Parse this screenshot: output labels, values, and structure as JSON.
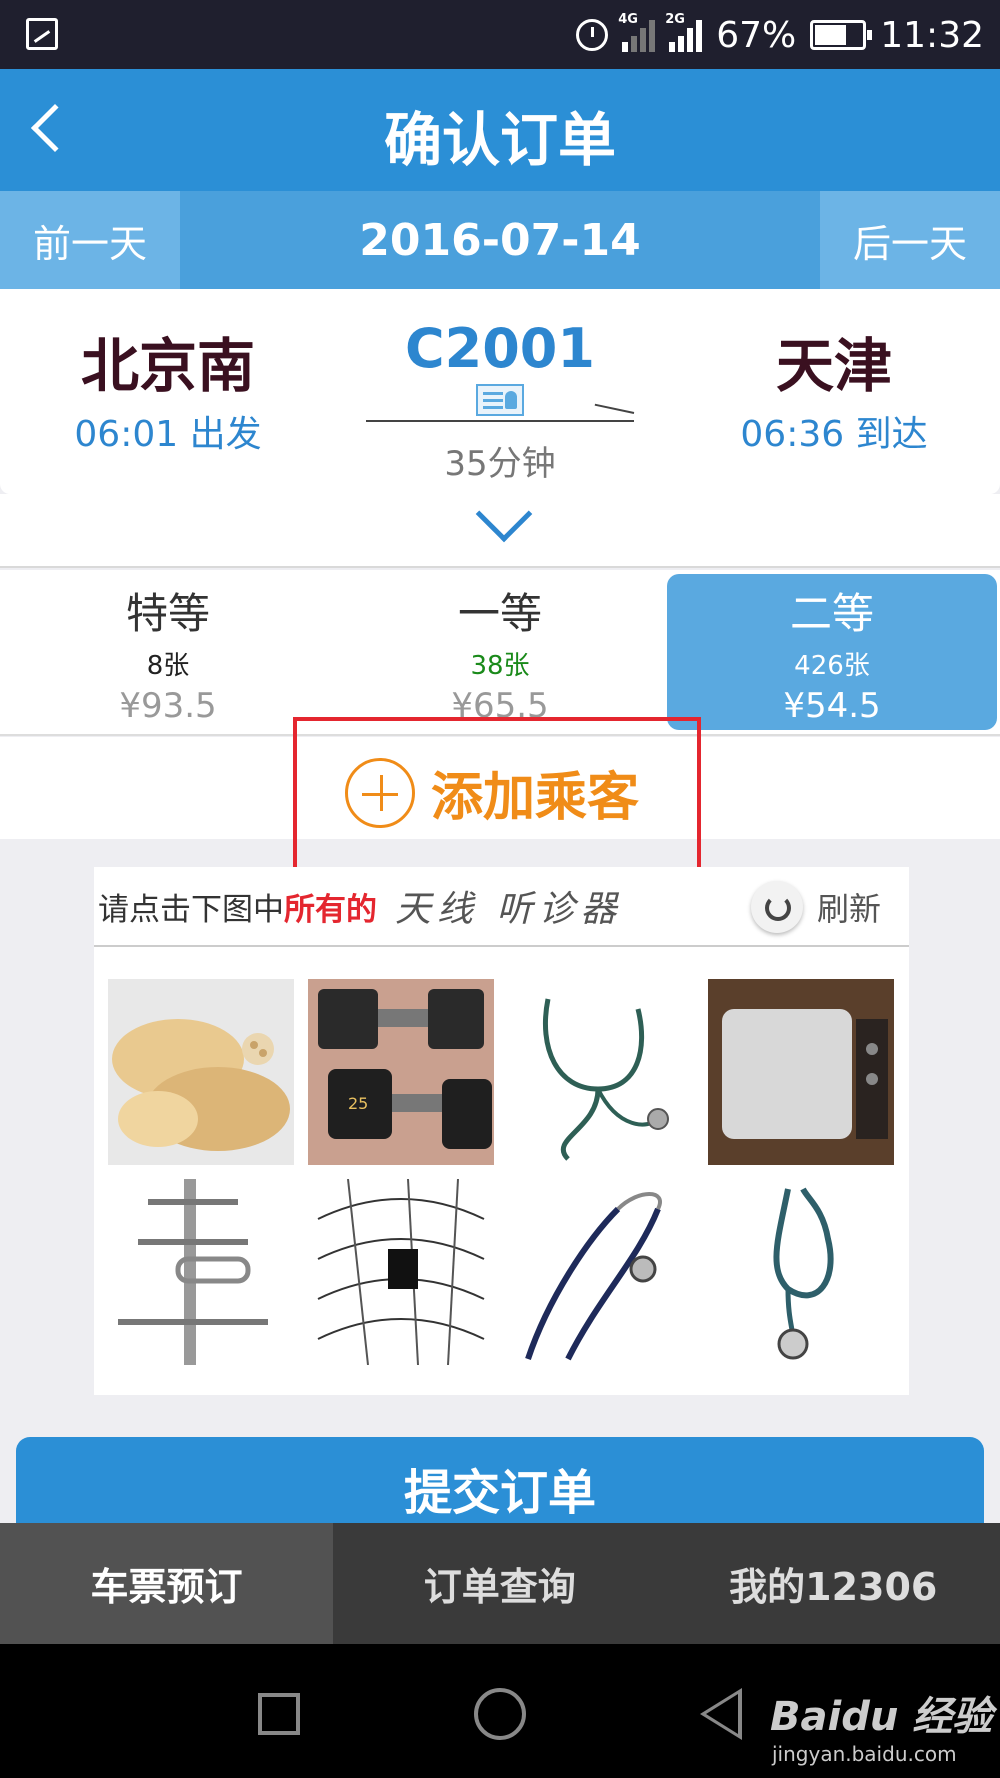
{
  "status_bar": {
    "network_1": "4G",
    "network_2": "2G",
    "battery": "67%",
    "battery_level": 0.67,
    "time": "11:32"
  },
  "header": {
    "title": "确认订单"
  },
  "date_bar": {
    "prev_label": "前一天",
    "date": "2016-07-14",
    "next_label": "后一天"
  },
  "train": {
    "from_station": "北京南",
    "from_time": "06:01 出发",
    "code": "C2001",
    "duration": "35分钟",
    "to_station": "天津",
    "to_time": "06:36 到达"
  },
  "seats": [
    {
      "class": "特等",
      "count": "8张",
      "price": "¥93.5"
    },
    {
      "class": "一等",
      "count": "38张",
      "price": "¥65.5"
    },
    {
      "class": "二等",
      "count": "426张",
      "price": "¥54.5"
    }
  ],
  "add_passenger": {
    "label": "添加乘客"
  },
  "captcha": {
    "prompt_prefix": "请点击下图中",
    "prompt_emphasis": "所有的",
    "target_words": "天线 听诊器",
    "refresh_label": "刷新",
    "images": [
      "lotus-root",
      "dumbbells",
      "stethoscope",
      "television",
      "antenna",
      "grid-antenna",
      "stethoscope",
      "stethoscope"
    ]
  },
  "submit": {
    "label": "提交订单"
  },
  "tabs": [
    {
      "label": "车票预订",
      "active": true
    },
    {
      "label": "订单查询",
      "active": false
    },
    {
      "label": "我的12306",
      "active": false
    }
  ],
  "watermark": {
    "main": "Baidu 经验",
    "sub": "jingyan.baidu.com"
  }
}
